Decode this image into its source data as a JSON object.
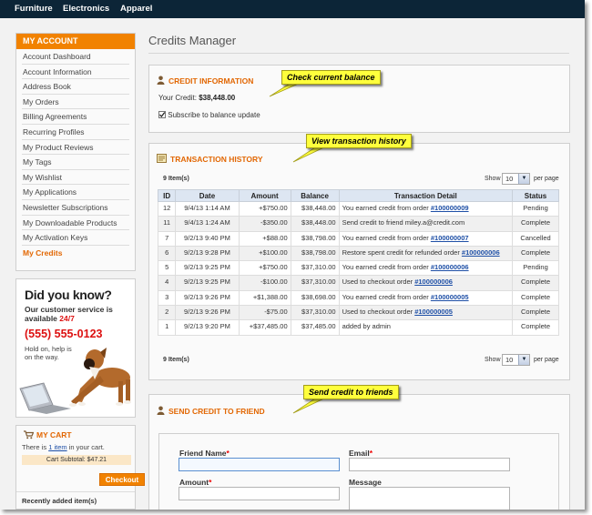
{
  "nav": [
    "Furniture",
    "Electronics",
    "Apparel"
  ],
  "account": {
    "heading": "MY ACCOUNT",
    "items": [
      "Account Dashboard",
      "Account Information",
      "Address Book",
      "My Orders",
      "Billing Agreements",
      "Recurring Profiles",
      "My Product Reviews",
      "My Tags",
      "My Wishlist",
      "My Applications",
      "Newsletter Subscriptions",
      "My Downloadable Products",
      "My Activation Keys",
      "My Credits"
    ],
    "active_item": "My Credits"
  },
  "promo": {
    "title": "Did you know?",
    "line1": "Our customer service is",
    "line2_prefix": "available ",
    "line2_highlight": "24/7",
    "phone": "(555) 555-0123",
    "note": "Hold on, help is on the way."
  },
  "cart": {
    "heading": "MY CART",
    "line_prefix": "There is ",
    "line_link": "1 item",
    "line_suffix": " in your cart.",
    "subtotal": "Cart Subtotal: $47.21",
    "checkout_label": "Checkout",
    "recent": "Recently added item(s)"
  },
  "page_title": "Credits Manager",
  "credit_info": {
    "heading": "CREDIT INFORMATION",
    "your_credit_label": "Your Credit:",
    "your_credit_value": "$38,448.00",
    "subscribe_label": "Subscribe to balance update"
  },
  "history": {
    "heading": "TRANSACTION HISTORY",
    "items_count": "9 Item(s)",
    "show_label": "Show",
    "per_page_value": "10",
    "per_page_label": "per page",
    "columns": [
      "ID",
      "Date",
      "Amount",
      "Balance",
      "Transaction Detail",
      "Status"
    ],
    "rows": [
      {
        "id": "12",
        "date": "9/4/13 1:14 AM",
        "amount": "+$750.00",
        "balance": "$38,448.00",
        "detail": "You earned credit from order ",
        "link": "#100000009",
        "status": "Pending"
      },
      {
        "id": "11",
        "date": "9/4/13 1:24 AM",
        "amount": "-$350.00",
        "balance": "$38,448.00",
        "detail": "Send credit to friend miley.a@credit.com",
        "link": "",
        "status": "Complete"
      },
      {
        "id": "7",
        "date": "9/2/13 9:40 PM",
        "amount": "+$88.00",
        "balance": "$38,798.00",
        "detail": "You earned credit from order ",
        "link": "#100000007",
        "status": "Cancelled"
      },
      {
        "id": "6",
        "date": "9/2/13 9:28 PM",
        "amount": "+$100.00",
        "balance": "$38,798.00",
        "detail": "Restore spent credit for refunded order ",
        "link": "#100000006",
        "status": "Complete"
      },
      {
        "id": "5",
        "date": "9/2/13 9:25 PM",
        "amount": "+$750.00",
        "balance": "$37,310.00",
        "detail": "You earned credit from order ",
        "link": "#100000006",
        "status": "Pending"
      },
      {
        "id": "4",
        "date": "9/2/13 9:25 PM",
        "amount": "-$100.00",
        "balance": "$37,310.00",
        "detail": "Used to checkout order ",
        "link": "#100000006",
        "status": "Complete"
      },
      {
        "id": "3",
        "date": "9/2/13 9:26 PM",
        "amount": "+$1,388.00",
        "balance": "$38,698.00",
        "detail": "You earned credit from order ",
        "link": "#100000005",
        "status": "Complete"
      },
      {
        "id": "2",
        "date": "9/2/13 9:26 PM",
        "amount": "-$75.00",
        "balance": "$37,310.00",
        "detail": "Used to checkout order ",
        "link": "#100000005",
        "status": "Complete"
      },
      {
        "id": "1",
        "date": "9/2/13 9:20 PM",
        "amount": "+$37,485.00",
        "balance": "$37,485.00",
        "detail": "added by admin",
        "link": "",
        "status": "Complete"
      }
    ]
  },
  "send_credit": {
    "heading": "SEND CREDIT TO FRIEND",
    "friend_name_label": "Friend Name",
    "email_label": "Email",
    "amount_label": "Amount",
    "message_label": "Message",
    "required_mark": "*"
  },
  "callouts": {
    "balance": "Check current balance",
    "history": "View transaction history",
    "send": "Send credit to friends"
  },
  "colors": {
    "nav_bg": "#0c2537",
    "accent": "#f18200",
    "heading_orange": "#e26703",
    "link": "#1e4fa6",
    "callout": "#ffff3c"
  }
}
